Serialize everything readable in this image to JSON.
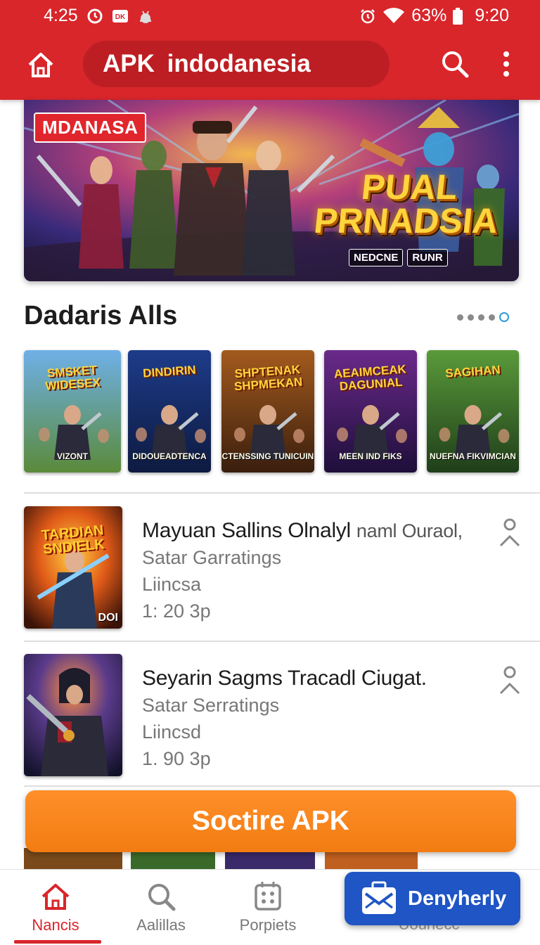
{
  "status_bar": {
    "time_left": "4:25",
    "battery": "63%",
    "time_right": "9:20",
    "icons": [
      "clock-icon",
      "notification-badge-icon",
      "android-icon",
      "alarm-icon",
      "wifi-icon",
      "battery-icon"
    ]
  },
  "app_bar": {
    "title": "APK indodanesia",
    "icons": [
      "home-icon",
      "search-icon",
      "more-vertical-icon"
    ]
  },
  "banner": {
    "tag": "MDANASA",
    "title_line1": "PUAL",
    "title_line2": "PRNADSIA",
    "sub_left": "NEDCNE",
    "sub_right": "RUNR"
  },
  "section": {
    "title": "Dadaris Alls",
    "carousel_pages": 5,
    "carousel_active_index": 4
  },
  "carousel": [
    {
      "title": "SMSKET WIDESEX",
      "caption": "VIZONT",
      "colors": [
        "#6fb0e8",
        "#5a8a3a"
      ]
    },
    {
      "title": "DINDIRIN",
      "caption": "DIDOUEADTENCA",
      "colors": [
        "#1d3c8a",
        "#0e1a40"
      ]
    },
    {
      "title": "SHPTENAK SHPMEKAN",
      "caption": "CTENSSING TUNICUIN",
      "colors": [
        "#a35a1d",
        "#3a1e0e"
      ]
    },
    {
      "title": "AEAIMCEAK DAGUNIAL",
      "caption": "MEEN IND FIKS",
      "colors": [
        "#6a2a8a",
        "#1e0e3a"
      ]
    },
    {
      "title": "SAGIHAN",
      "caption": "NUEFNA FIKVIMCIAN",
      "colors": [
        "#5a9a3a",
        "#1f3e1a"
      ]
    }
  ],
  "list_items": [
    {
      "thumb_title": "TARDIAN SNDIELK",
      "thumb_badge": "DOI",
      "title": "Mayuan Sallins Olnalyl",
      "title_extra": "naml Ouraol,",
      "line1": "Satar Garratings",
      "line2": "Liincsa",
      "line3": "1: 20 3p"
    },
    {
      "thumb_title": "",
      "thumb_badge": "",
      "title": "Seyarin Sagms Tracadl Ciugat.",
      "title_extra": "",
      "line1": "Satar Serratings",
      "line2": "Liincsd",
      "line3": "1. 90 3p"
    }
  ],
  "cta": {
    "label": "Soctire APK"
  },
  "bottom_nav": [
    {
      "label": "Nancis",
      "icon": "home-icon",
      "active": true
    },
    {
      "label": "Aalillas",
      "icon": "search-icon",
      "active": false
    },
    {
      "label": "Porpiets",
      "icon": "dice-icon",
      "active": false
    }
  ],
  "fab": {
    "label": "Denyherly",
    "icon": "briefcase-mail-icon",
    "ghost_label": "Uounecc"
  },
  "colors": {
    "primary": "#d8262b",
    "primary_dark": "#bd1e23",
    "cta": "#f58320",
    "fab": "#1f55c4",
    "indicator_active": "#2f9ad8"
  }
}
